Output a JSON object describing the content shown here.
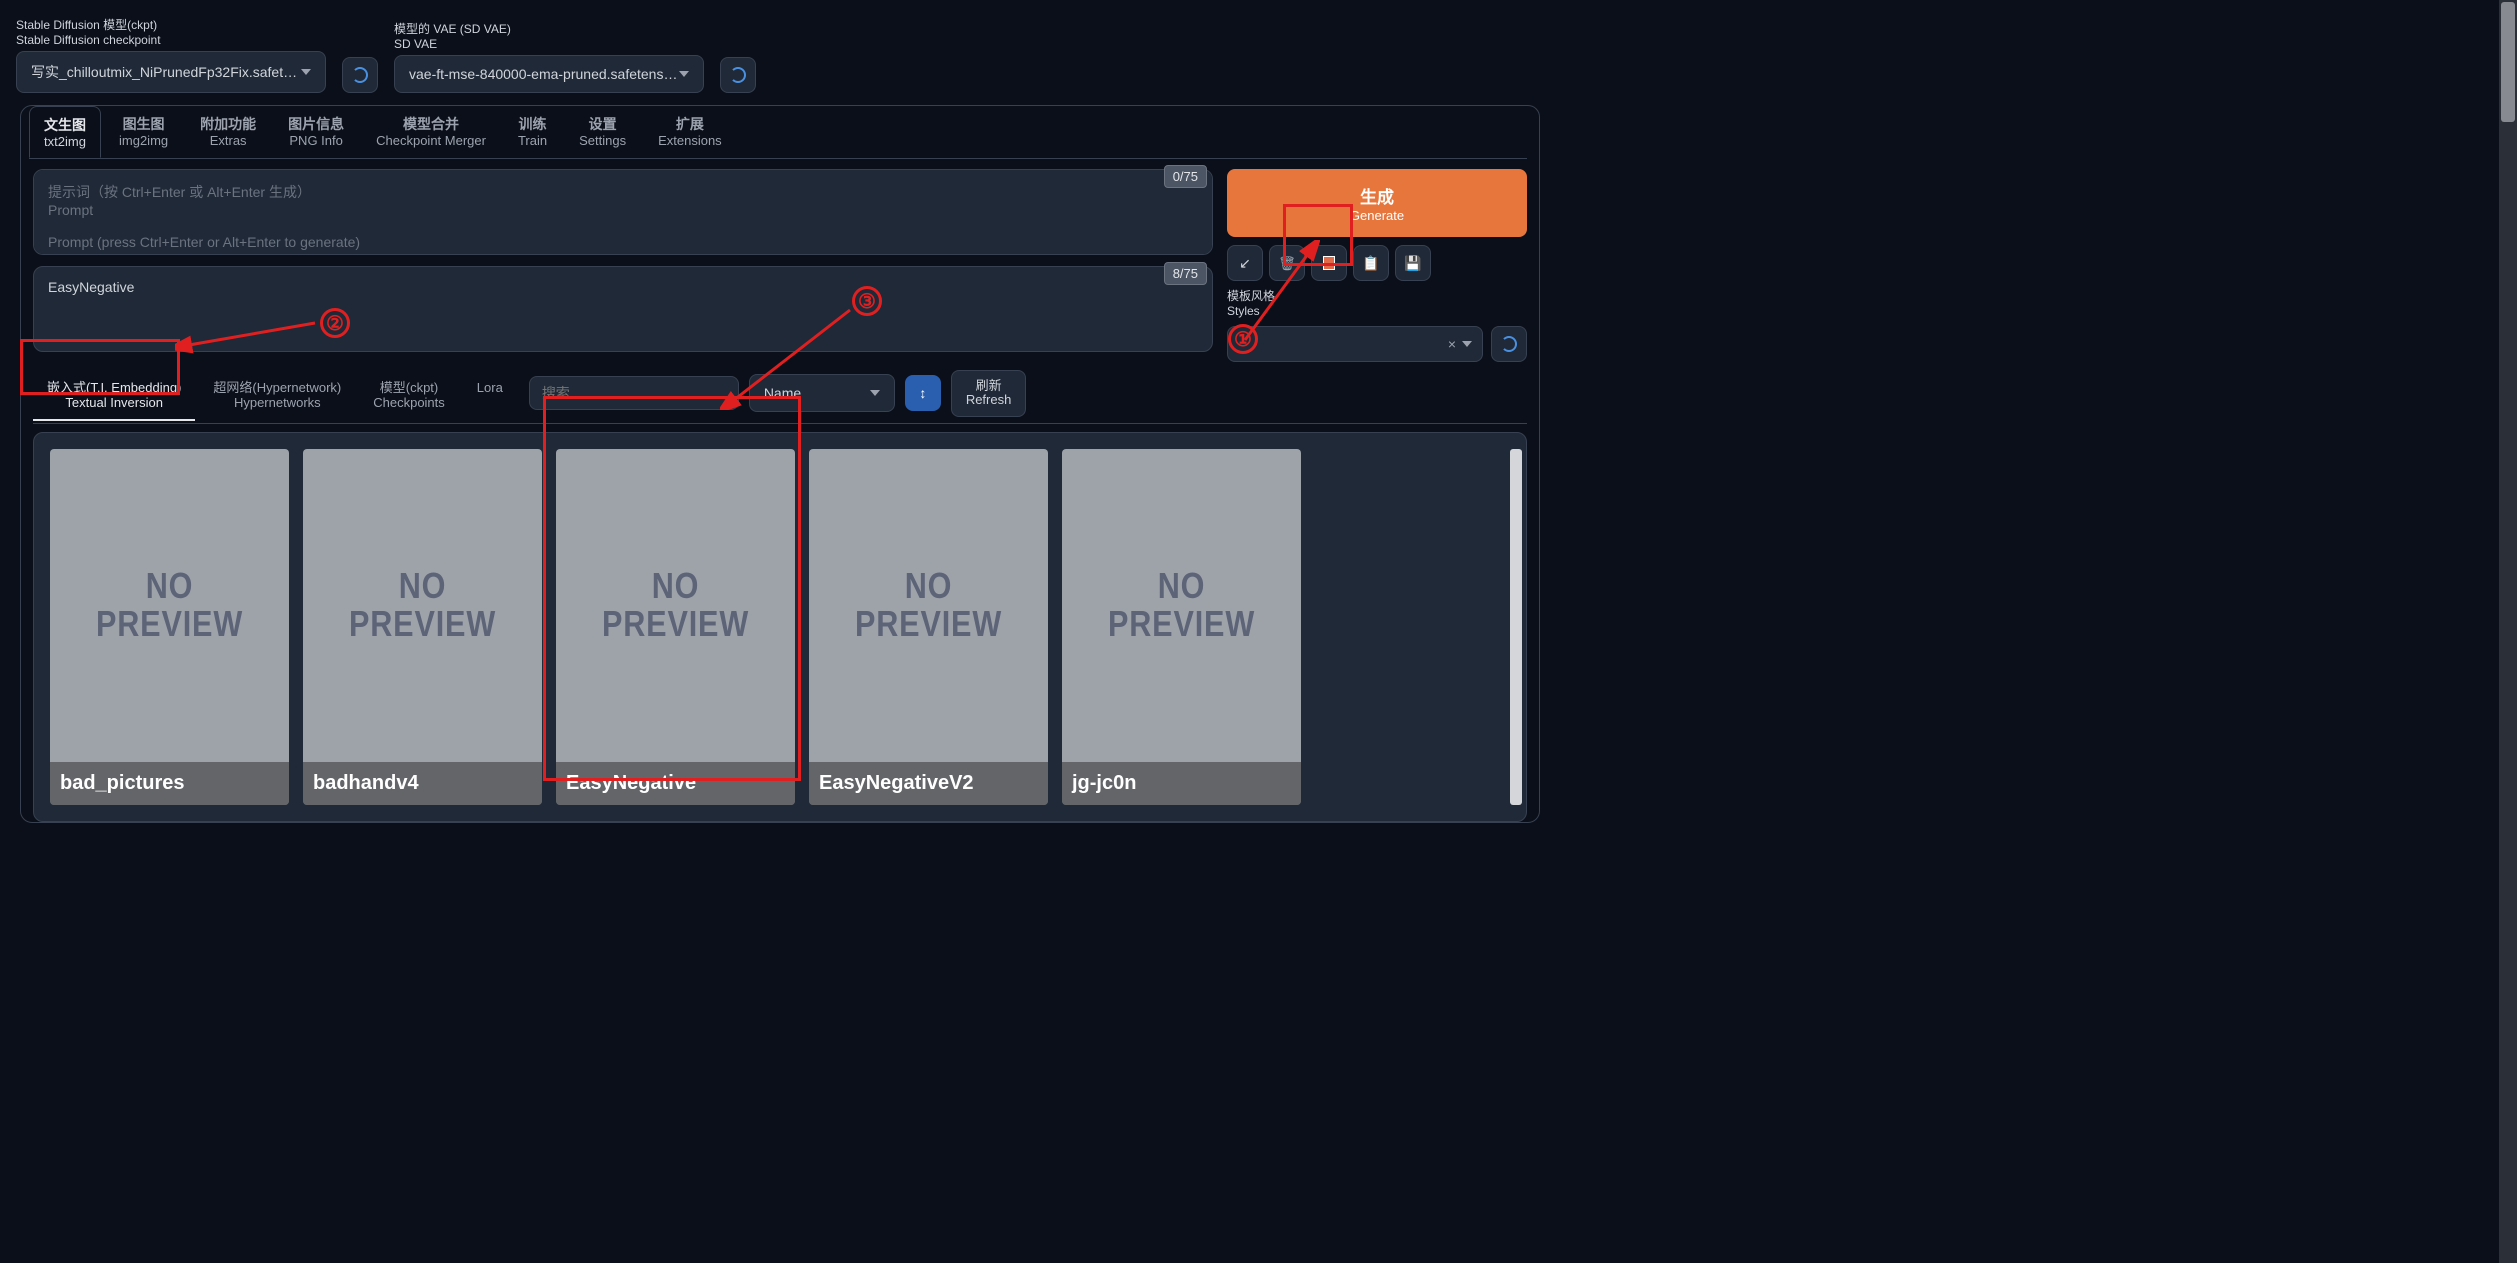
{
  "top": {
    "ckpt_label_cn": "Stable Diffusion 模型(ckpt)",
    "ckpt_label_en": "Stable Diffusion checkpoint",
    "ckpt_value": "写实_chilloutmix_NiPrunedFp32Fix.safetensors",
    "vae_label_cn": "模型的 VAE (SD VAE)",
    "vae_label_en": "SD VAE",
    "vae_value": "vae-ft-mse-840000-ema-pruned.safetensors"
  },
  "tabs": [
    {
      "cn": "文生图",
      "en": "txt2img"
    },
    {
      "cn": "图生图",
      "en": "img2img"
    },
    {
      "cn": "附加功能",
      "en": "Extras"
    },
    {
      "cn": "图片信息",
      "en": "PNG Info"
    },
    {
      "cn": "模型合并",
      "en": "Checkpoint Merger"
    },
    {
      "cn": "训练",
      "en": "Train"
    },
    {
      "cn": "设置",
      "en": "Settings"
    },
    {
      "cn": "扩展",
      "en": "Extensions"
    }
  ],
  "prompt": {
    "placeholder": "提示词（按 Ctrl+Enter 或 Alt+Enter 生成）\nPrompt\n\nPrompt (press Ctrl+Enter or Alt+Enter to generate)",
    "counter": "0/75"
  },
  "neg_prompt": {
    "value": "EasyNegative",
    "counter": "8/75"
  },
  "right": {
    "generate_cn": "生成",
    "generate_en": "Generate",
    "styles_cn": "模板风格",
    "styles_en": "Styles"
  },
  "extra_tabs": [
    {
      "cn": "嵌入式(T.I. Embedding)",
      "en": "Textual Inversion"
    },
    {
      "cn": "超网络(Hypernetwork)",
      "en": "Hypernetworks"
    },
    {
      "cn": "模型(ckpt)",
      "en": "Checkpoints"
    },
    {
      "cn": "Lora",
      "en": ""
    }
  ],
  "extra_controls": {
    "search_placeholder": "搜索...",
    "sort_value": "Name",
    "refresh_cn": "刷新",
    "refresh_en": "Refresh"
  },
  "cards": [
    {
      "name": "bad_pictures",
      "preview_text": "NO\nPREVIEW"
    },
    {
      "name": "badhandv4",
      "preview_text": "NO\nPREVIEW"
    },
    {
      "name": "EasyNegative",
      "preview_text": "NO\nPREVIEW"
    },
    {
      "name": "EasyNegativeV2",
      "preview_text": "NO\nPREVIEW"
    },
    {
      "name": "jg-jc0n",
      "preview_text": "NO\nPREVIEW"
    }
  ],
  "annotations": {
    "a1": "①",
    "a2": "②",
    "a3": "③"
  }
}
